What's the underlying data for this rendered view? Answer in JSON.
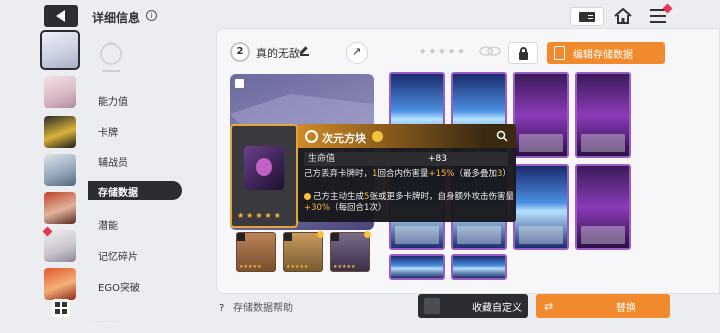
{
  "header": {
    "title": "详细信息",
    "info_icon": "i"
  },
  "nav": {
    "items": [
      "能力值",
      "卡牌",
      "辅战员",
      "潜能",
      "记忆碎片",
      "EGO突破"
    ],
    "active": "存储数据"
  },
  "deck": {
    "level": "2",
    "name": "真的无敌",
    "edit_label": "编辑存储数据"
  },
  "tooltip": {
    "name": "次元方块",
    "stat_label": "生命值",
    "stat_value": "+83",
    "desc1_a": "己方丢弃卡牌时，",
    "desc1_b": "1",
    "desc1_c": "回合内伤害量",
    "desc1_d": "+15%",
    "desc1_e": "（最多叠加",
    "desc1_f": "3",
    "desc1_g": "）",
    "desc2_a": "己方主动生成",
    "desc2_b": "5",
    "desc2_c": "张或更多卡牌时，自身额外攻击伤害量",
    "desc2_d": "+30%",
    "desc2_e": "（每回合1次）",
    "stars": "★★★★★"
  },
  "footer": {
    "help": "存储数据帮助",
    "collect": "收藏自定义",
    "replace": "替换"
  },
  "colors": {
    "accent": "#f08a2c",
    "dark": "#2b2d33",
    "highlight": "#f5b83d"
  }
}
